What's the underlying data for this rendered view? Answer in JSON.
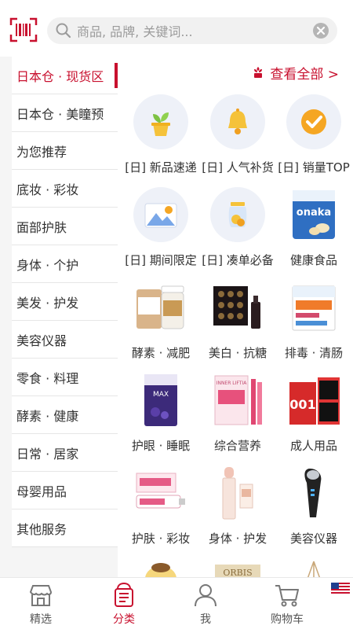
{
  "search": {
    "placeholder": "商品, 品牌, 关键词..."
  },
  "sidebar": {
    "items": [
      {
        "label": "日本仓 · 现货区",
        "active": true
      },
      {
        "label": "日本仓 · 美瞳预"
      },
      {
        "label": "为您推荐"
      },
      {
        "label": "底妆 · 彩妆"
      },
      {
        "label": "面部护肤"
      },
      {
        "label": "身体 · 个护"
      },
      {
        "label": "美发 · 护发"
      },
      {
        "label": "美容仪器"
      },
      {
        "label": "零食 · 料理"
      },
      {
        "label": "酵素 · 健康"
      },
      {
        "label": "日常 · 居家"
      },
      {
        "label": "母婴用品"
      },
      {
        "label": "其他服务"
      }
    ]
  },
  "main": {
    "view_all": "查看全部 >",
    "categories": [
      {
        "label": "[日] 新品速递",
        "icon": "potted-sprout-icon"
      },
      {
        "label": "[日] 人气补货",
        "icon": "bell-icon"
      },
      {
        "label": "[日] 销量TOP",
        "icon": "check-badge-icon"
      },
      {
        "label": "[日] 期间限定",
        "icon": "mountain-sun-icon"
      },
      {
        "label": "[日] 凑单必备",
        "icon": "coin-jar-icon"
      },
      {
        "label": "健康食品",
        "icon": "onaka-supplement-bag"
      },
      {
        "label": "酵素 · 减肥",
        "icon": "enzyme-bottle"
      },
      {
        "label": "美白 · 抗糖",
        "icon": "black-gift-box"
      },
      {
        "label": "排毒 · 清肠",
        "icon": "detox-supplement-box"
      },
      {
        "label": "护眼 · 睡眠",
        "icon": "blueberry-supplement-pack"
      },
      {
        "label": "综合营养",
        "icon": "inner-lifta-box"
      },
      {
        "label": "成人用品",
        "icon": "condom-boxes"
      },
      {
        "label": "护肤 · 彩妆",
        "icon": "skincare-tube-box"
      },
      {
        "label": "身体 · 护发",
        "icon": "lip-balm-stick"
      },
      {
        "label": "美容仪器",
        "icon": "beauty-device"
      }
    ],
    "partial_row": [
      "pompompurin-plush",
      "orbis-box",
      "tripod-stand"
    ]
  },
  "tabbar": {
    "tabs": [
      {
        "label": "精选",
        "icon": "store-icon"
      },
      {
        "label": "分类",
        "icon": "category-bag-icon",
        "active": true
      },
      {
        "label": "我",
        "icon": "person-icon"
      },
      {
        "label": "购物车",
        "icon": "cart-icon"
      }
    ]
  },
  "colors": {
    "accent": "#c8102e",
    "sidebar_bg": "#f5f5f5",
    "icon_circle": "#eef1f8"
  }
}
